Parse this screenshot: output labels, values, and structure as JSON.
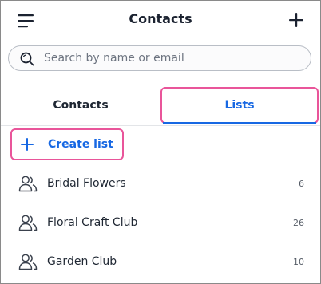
{
  "header": {
    "title": "Contacts",
    "menu_icon": "hamburger-menu-icon",
    "add_icon": "plus-icon"
  },
  "search": {
    "placeholder": "Search by name or email",
    "value": ""
  },
  "tabs": [
    {
      "label": "Contacts",
      "active": false
    },
    {
      "label": "Lists",
      "active": true
    }
  ],
  "create_list": {
    "label": "Create list",
    "icon": "plus-icon"
  },
  "lists": [
    {
      "name": "Bridal Flowers",
      "count": "6"
    },
    {
      "name": "Floral Craft Club",
      "count": "26"
    },
    {
      "name": "Garden Club",
      "count": "10"
    }
  ],
  "colors": {
    "accent": "#1768e3",
    "highlight": "#e9559a",
    "text": "#1f2733"
  }
}
